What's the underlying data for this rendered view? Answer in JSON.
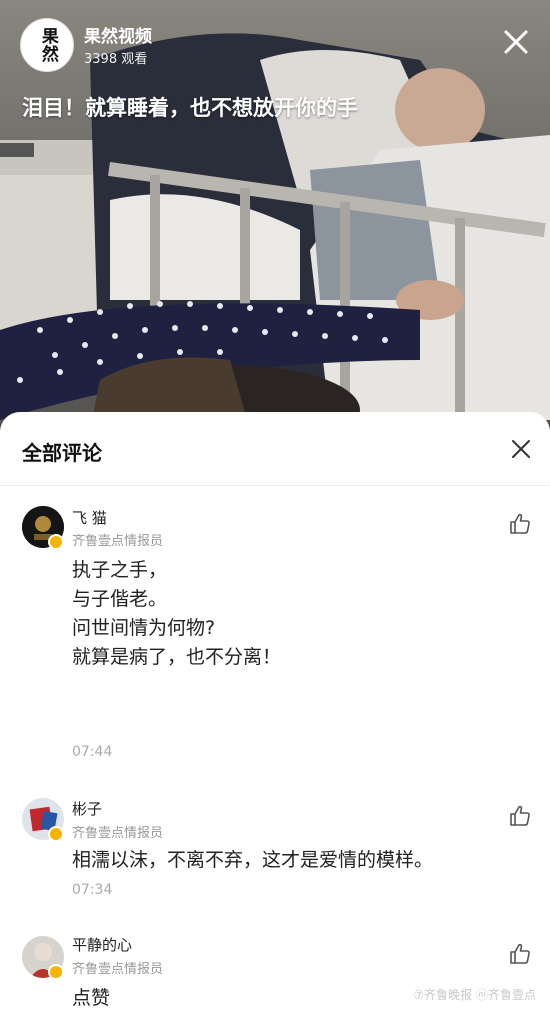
{
  "video": {
    "channel_name": "果然视频",
    "logo_text": "果然",
    "views": "3398 观看",
    "title": "泪目！就算睡着，也不想放开你的手",
    "close_icon": "close-icon"
  },
  "comments_panel": {
    "title": "全部评论",
    "close_icon": "close-icon",
    "comments": [
      {
        "name": "飞 猫",
        "role": "齐鲁壹点情报员",
        "lines": [
          "执子之手，",
          "与子偕老。",
          "问世间情为何物?",
          "就算是病了，也不分离！"
        ],
        "time": "07:44"
      },
      {
        "name": "彬子",
        "role": "齐鲁壹点情报员",
        "lines": [
          "相濡以沫，不离不弃，这才是爱情的模样。"
        ],
        "time": "07:34"
      },
      {
        "name": "平静的心",
        "role": "齐鲁壹点情报员",
        "lines": [
          "点赞"
        ],
        "time": ""
      }
    ]
  },
  "watermark": "⑦齐鲁晚报 ⓜ齐鲁壹点",
  "colors": {
    "badge": "#f5b400",
    "role_text": "#999999",
    "time_text": "#aaaaaa"
  }
}
